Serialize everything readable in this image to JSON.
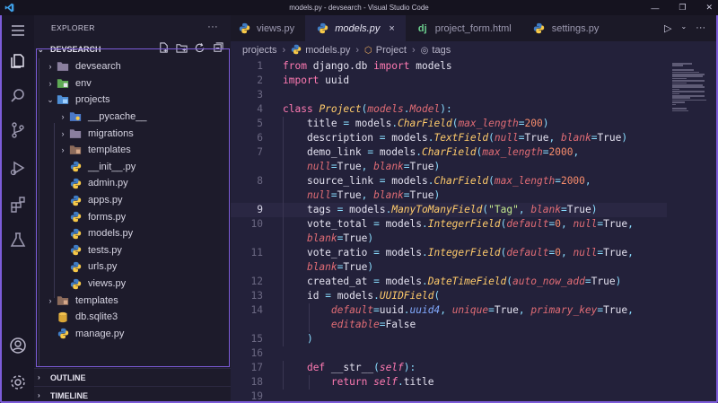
{
  "window": {
    "title": "models.py - devsearch - Visual Studio Code",
    "logo": "vscode-logo-icon",
    "controls": [
      "minimize-icon",
      "restore-icon",
      "close-icon"
    ]
  },
  "activity_bar": {
    "items": [
      {
        "name": "menu-icon"
      },
      {
        "name": "explorer-icon"
      },
      {
        "name": "search-icon"
      },
      {
        "name": "source-control-icon"
      },
      {
        "name": "run-debug-icon"
      },
      {
        "name": "extensions-icon"
      },
      {
        "name": "testing-icon"
      },
      {
        "name": "account-icon"
      },
      {
        "name": "settings-gear-icon"
      }
    ]
  },
  "sidebar": {
    "header": "EXPLORER",
    "more": "···",
    "workspace": "DEVSEARCH",
    "tree": [
      {
        "label": "devsearch",
        "type": "folder",
        "depth": 1,
        "expanded": false
      },
      {
        "label": "env",
        "type": "folder-env",
        "depth": 1,
        "expanded": false
      },
      {
        "label": "projects",
        "type": "folder-project",
        "depth": 1,
        "expanded": true
      },
      {
        "label": "__pycache__",
        "type": "folder-py",
        "depth": 2,
        "expanded": false
      },
      {
        "label": "migrations",
        "type": "folder",
        "depth": 2,
        "expanded": false
      },
      {
        "label": "templates",
        "type": "folder-tpl",
        "depth": 2,
        "expanded": false
      },
      {
        "label": "__init__.py",
        "type": "python",
        "depth": 2
      },
      {
        "label": "admin.py",
        "type": "python",
        "depth": 2
      },
      {
        "label": "apps.py",
        "type": "python",
        "depth": 2
      },
      {
        "label": "forms.py",
        "type": "python",
        "depth": 2
      },
      {
        "label": "models.py",
        "type": "python",
        "depth": 2
      },
      {
        "label": "tests.py",
        "type": "python",
        "depth": 2
      },
      {
        "label": "urls.py",
        "type": "python",
        "depth": 2
      },
      {
        "label": "views.py",
        "type": "python",
        "depth": 2
      },
      {
        "label": "templates",
        "type": "folder-tpl",
        "depth": 1,
        "expanded": false
      },
      {
        "label": "db.sqlite3",
        "type": "database",
        "depth": 1
      },
      {
        "label": "manage.py",
        "type": "python",
        "depth": 1
      }
    ],
    "outline": "OUTLINE",
    "timeline": "TIMELINE"
  },
  "tabs": [
    {
      "label": "views.py",
      "icon": "python-icon",
      "active": false
    },
    {
      "label": "models.py",
      "icon": "python-icon",
      "active": true,
      "close": "×"
    },
    {
      "label": "project_form.html",
      "icon": "django-icon",
      "active": false
    },
    {
      "label": "settings.py",
      "icon": "python-icon",
      "active": false
    }
  ],
  "breadcrumb": {
    "items": [
      "projects",
      "models.py",
      "Project",
      "tags"
    ]
  },
  "editor": {
    "current_line": 9,
    "lines": [
      {
        "n": "1"
      },
      {
        "n": "2"
      },
      {
        "n": "3"
      },
      {
        "n": "4"
      },
      {
        "n": "5"
      },
      {
        "n": "6"
      },
      {
        "n": "7"
      },
      {
        "n": ""
      },
      {
        "n": "8"
      },
      {
        "n": ""
      },
      {
        "n": "9"
      },
      {
        "n": "10"
      },
      {
        "n": ""
      },
      {
        "n": "11"
      },
      {
        "n": ""
      },
      {
        "n": "12"
      },
      {
        "n": "13"
      },
      {
        "n": "14"
      },
      {
        "n": ""
      },
      {
        "n": "15"
      },
      {
        "n": "16"
      },
      {
        "n": "17"
      },
      {
        "n": "18"
      },
      {
        "n": "19"
      }
    ]
  },
  "colors": {
    "accent": "#7c5cd8",
    "editor_bg": "#23213a",
    "sidebar_bg": "#1d1b2b",
    "keyword": "#ff7ab2",
    "class_name": "#ffcb6b",
    "string": "#c3e88d",
    "number": "#f78c6c"
  }
}
